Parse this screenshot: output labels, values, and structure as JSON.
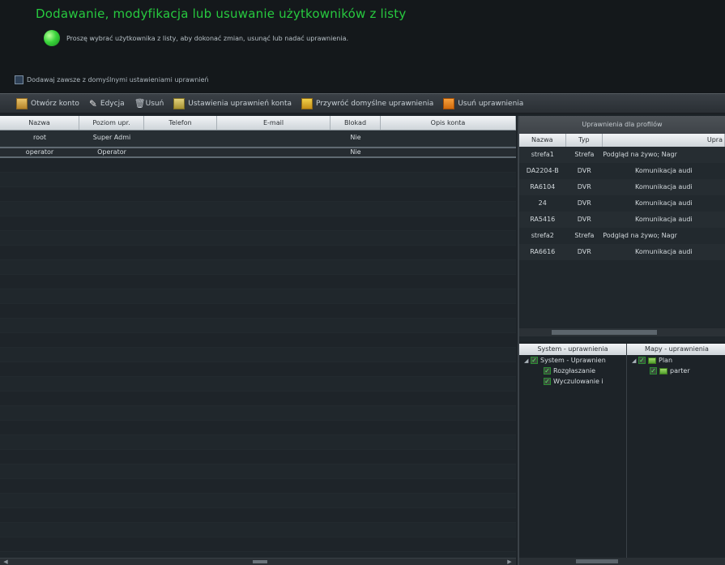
{
  "header": {
    "title": "Dodawanie, modyfikacja lub usuwanie użytkowników z listy",
    "info": "Proszę wybrać użytkownika z listy, aby dokonać zmian, usunąć lub nadać uprawnienia.",
    "add_default_label": "Dodawaj zawsze z domyślnymi ustawieniami uprawnień"
  },
  "toolbar": {
    "open_account": "Otwórz konto",
    "edit": "Edycja",
    "delete": "Usuń",
    "account_permissions": "Ustawienia uprawnień konta",
    "restore_defaults": "Przywróć domyślne uprawnienia",
    "remove_permissions": "Usuń uprawnienia"
  },
  "users_table": {
    "columns": [
      "Nazwa",
      "Poziom upr.",
      "Telefon",
      "E-mail",
      "Blokad",
      "Opis konta"
    ],
    "rows": [
      [
        "root",
        "Super Admi",
        "",
        "",
        "Nie",
        ""
      ],
      [
        "operator",
        "Operator",
        "",
        "",
        "Nie",
        ""
      ]
    ]
  },
  "permissions": {
    "title": "Uprawnienia dla profilów",
    "columns": [
      "Nazwa",
      "Typ",
      "Upra"
    ],
    "rows": [
      [
        "strefa1",
        "Strefa",
        "Podgląd na żywo; Nagr"
      ],
      [
        "DA2204-B",
        "DVR",
        "Komunikacja audi"
      ],
      [
        "RA6104",
        "DVR",
        "Komunikacja audi"
      ],
      [
        "24",
        "DVR",
        "Komunikacja audi"
      ],
      [
        "RA5416",
        "DVR",
        "Komunikacja audi"
      ],
      [
        "strefa2",
        "Strefa",
        "Podgląd na żywo; Nagr"
      ],
      [
        "RA6616",
        "DVR",
        "Komunikacja audi"
      ]
    ]
  },
  "system_permissions": {
    "header": "System - uprawnienia",
    "root": "System - Uprawnien",
    "children": [
      "Rozgłaszanie",
      "Wyczulowanie i"
    ]
  },
  "map_permissions": {
    "header": "Mapy - uprawnienia",
    "root": "Plan",
    "children": [
      "parter"
    ]
  }
}
